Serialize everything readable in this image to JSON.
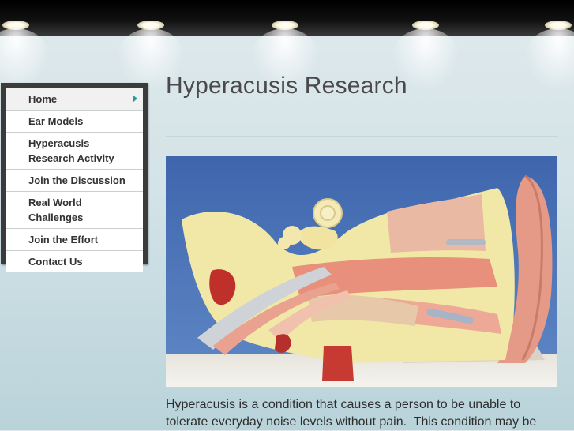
{
  "navigation": {
    "items": [
      {
        "label": "Home",
        "active": true
      },
      {
        "label": "Ear Models"
      },
      {
        "label": "Hyperacusis Research Activity"
      },
      {
        "label": "Join the Discussion"
      },
      {
        "label": "Real World Challenges"
      },
      {
        "label": "Join the Effort"
      },
      {
        "label": "Contact Us"
      }
    ]
  },
  "page": {
    "title": "Hyperacusis Research",
    "body_text": "Hyperacusis is a condition that causes a person to be unable to\ntolerate everyday noise levels without pain.  This condition may be"
  },
  "image": {
    "subject": "anatomical-ear-model"
  },
  "colors": {
    "accent": "#2a9d9a",
    "nav_frame": "#3b3b3b",
    "title": "#4a4a4a"
  }
}
